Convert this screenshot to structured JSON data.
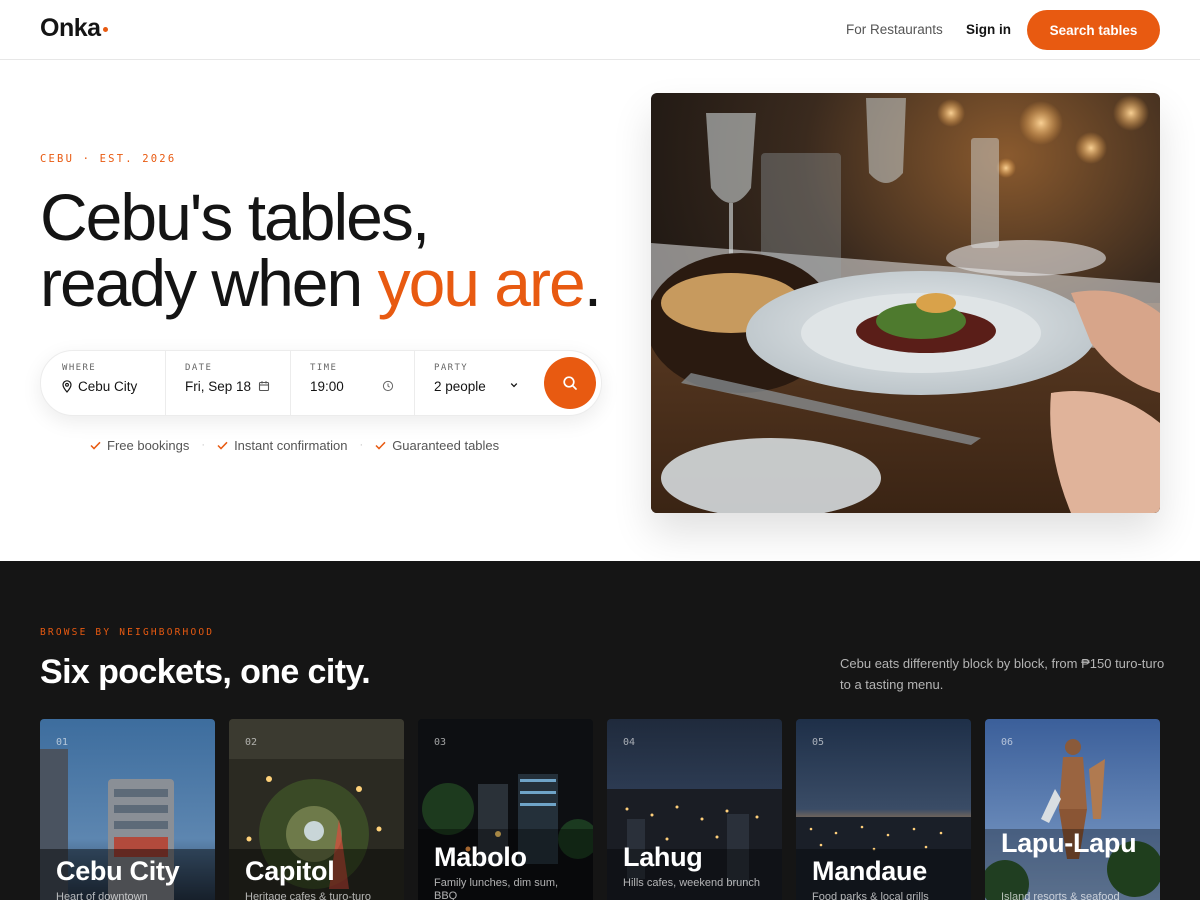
{
  "header": {
    "logo": "Onka",
    "nav": {
      "for_restaurants": "For Restaurants",
      "sign_in": "Sign in"
    },
    "cta": "Search tables"
  },
  "hero": {
    "eyebrow": "CEBU · EST. 2026",
    "title_line1": "Cebu's tables,",
    "title_line2_plain": "ready when ",
    "title_line2_accent": "you are",
    "title_line2_end": ".",
    "search": {
      "where_label": "WHERE",
      "where_value": "Cebu City",
      "date_label": "DATE",
      "date_value": "Fri, Sep 18",
      "time_label": "TIME",
      "time_value": "19:00",
      "party_label": "PARTY",
      "party_value": "2 people"
    },
    "perks": [
      "Free bookings",
      "Instant confirmation",
      "Guaranteed tables"
    ]
  },
  "neighborhoods": {
    "eyebrow": "BROWSE BY NEIGHBORHOOD",
    "title": "Six pockets, one city.",
    "description": "Cebu eats differently block by block, from ₱150 turo-turo to a tasting menu.",
    "cards": [
      {
        "num": "01",
        "name": "Cebu City",
        "subtitle": "Heart of downtown"
      },
      {
        "num": "02",
        "name": "Capitol",
        "subtitle": "Heritage cafes & turo-turo"
      },
      {
        "num": "03",
        "name": "Mabolo",
        "subtitle": "Family lunches, dim sum, BBQ"
      },
      {
        "num": "04",
        "name": "Lahug",
        "subtitle": "Hills cafes, weekend brunch"
      },
      {
        "num": "05",
        "name": "Mandaue",
        "subtitle": "Food parks & local grills"
      },
      {
        "num": "06",
        "name": "Lapu-Lapu",
        "subtitle": "Island resorts & seafood"
      }
    ]
  },
  "colors": {
    "accent": "#e85a11",
    "dark_bg": "#151515",
    "text": "#141414"
  },
  "icons": [
    "map-pin-icon",
    "calendar-icon",
    "clock-icon",
    "chevron-down-icon",
    "search-icon",
    "check-icon"
  ]
}
